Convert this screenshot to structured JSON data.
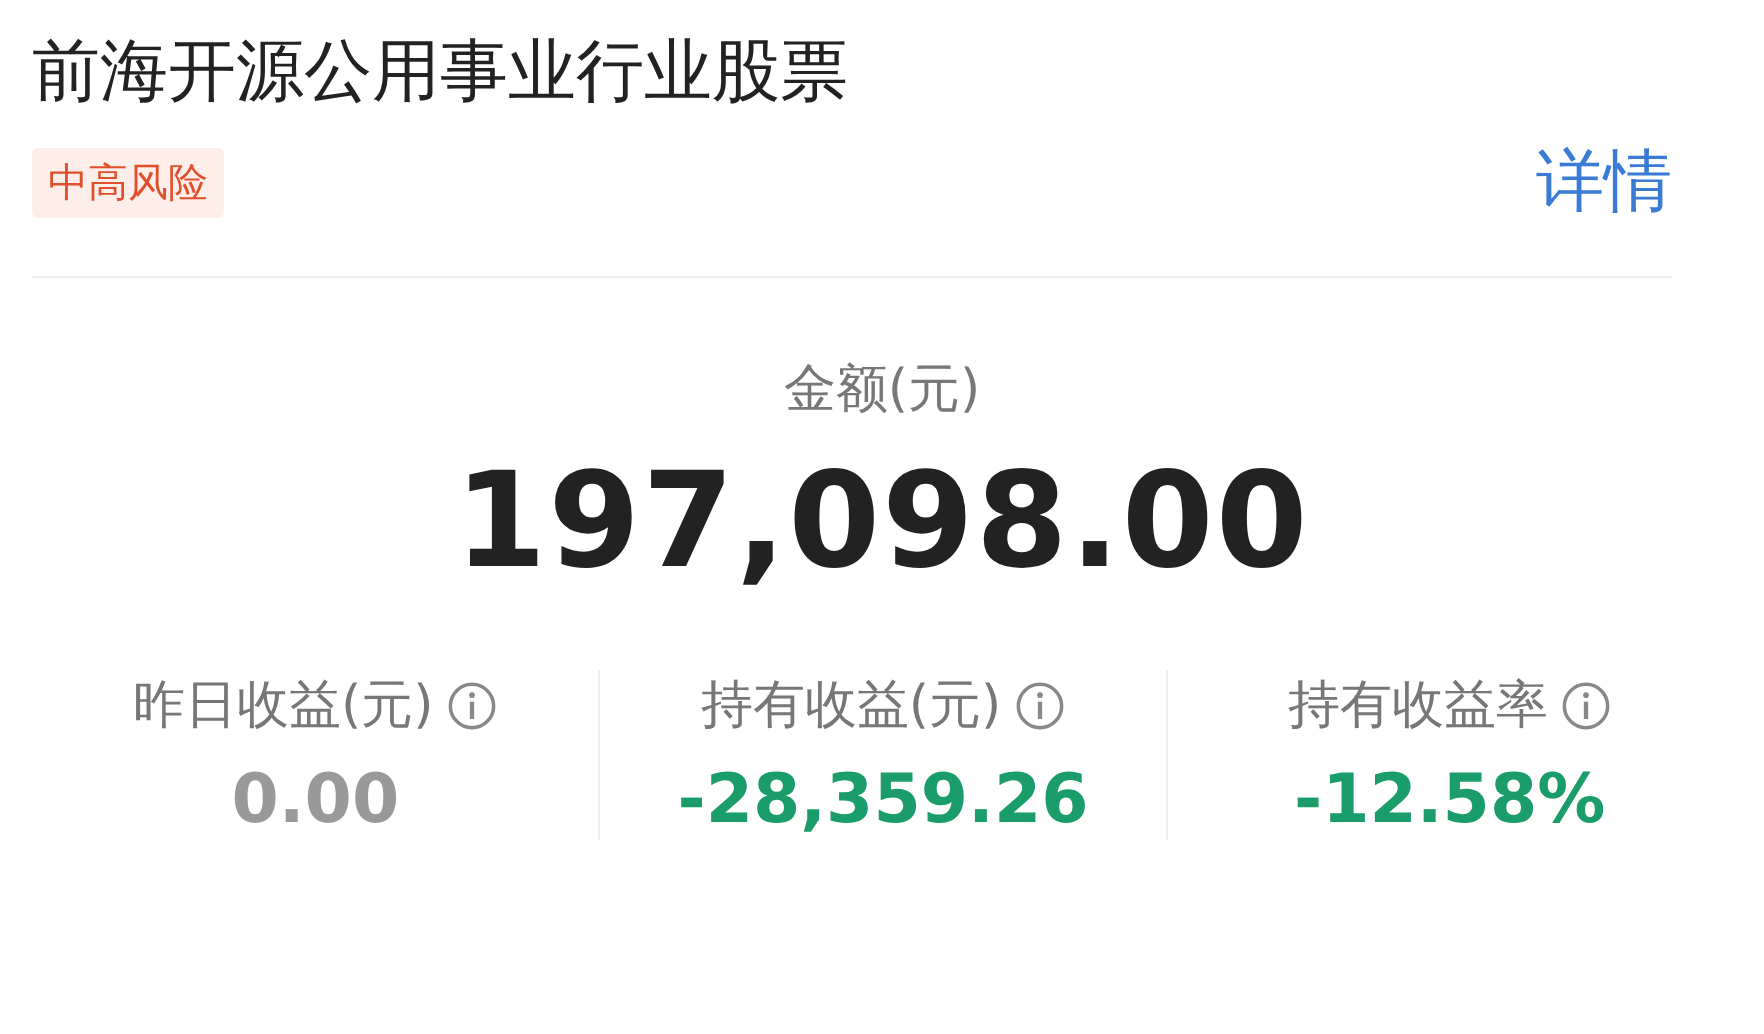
{
  "fund": {
    "name": "前海开源公用事业行业股票",
    "risk_tag": "中高风险",
    "detail_link": "详情"
  },
  "amount": {
    "label": "金额(元)",
    "value": "197,098.00"
  },
  "stats": [
    {
      "label": "昨日收益(元)",
      "value": "0.00",
      "kind": "flat"
    },
    {
      "label": "持有收益(元)",
      "value": "-28,359.26",
      "kind": "loss"
    },
    {
      "label": "持有收益率",
      "value": "-12.58%",
      "kind": "loss"
    }
  ]
}
